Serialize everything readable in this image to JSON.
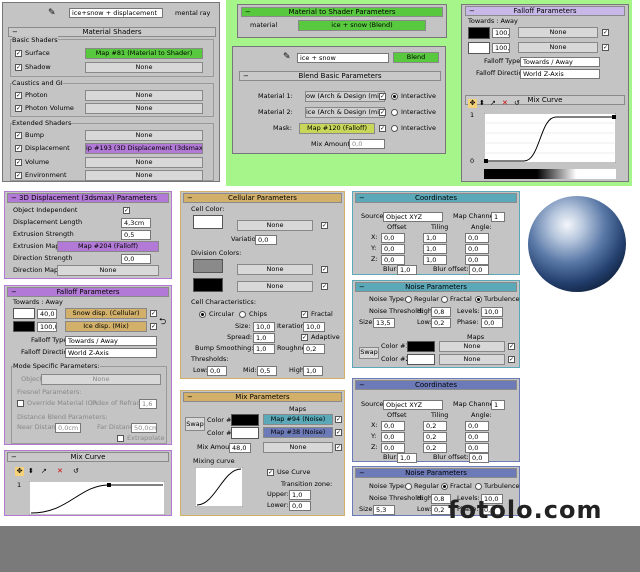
{
  "top_left": {
    "map_dropdown": "ice+snow + displacement",
    "map_type": "mental ray",
    "title": "Material Shaders",
    "basic_header": "Basic Shaders",
    "surface_label": "Surface",
    "surface_map": "Map #81 (Material to Shader)",
    "shadow_label": "Shadow",
    "none": "None",
    "caustics_header": "Caustics and GI",
    "photon_label": "Photon",
    "photon_volume_label": "Photon Volume",
    "extended_header": "Extended Shaders",
    "bump_label": "Bump",
    "displacement_label": "Displacement",
    "displacement_map": "ip #193 (3D Displacement (3dsmax))",
    "volume_label": "Volume",
    "environment_label": "Environment"
  },
  "mat_to_shader": {
    "title": "Material to Shader Parameters",
    "material_label": "material",
    "material_value": "ice + snow (Blend)"
  },
  "blend": {
    "dropdown": "ice + snow",
    "type": "Blend",
    "title": "Blend Basic Parameters",
    "m1_label": "Material 1:",
    "m1_value": "ow (Arch & Design (mi))",
    "m2_label": "Material 2:",
    "m2_value": "ice (Arch & Design (mi))",
    "mask_label": "Mask:",
    "mask_value": "Map #120 (Falloff)",
    "interactive": "Interactive",
    "mix_label": "Mix Amount:",
    "mix_value": "0,0"
  },
  "falloff_top": {
    "title": "Falloff Parameters",
    "towards_label": "Towards : Away",
    "v1": "100,0",
    "v2": "100,0",
    "none": "None",
    "type_label": "Falloff Type:",
    "type_value": "Towards / Away",
    "dir_label": "Falloff Direction:",
    "dir_value": "World Z-Axis",
    "mix_curve": "Mix Curve",
    "y1": "1",
    "y0": "0"
  },
  "disp3d": {
    "title": "3D Displacement (3dsmax) Parameters",
    "obj_ind": "Object Independent",
    "disp_len_label": "Displacement Length",
    "disp_len_value": "4,3cm",
    "ext_str_label": "Extrusion Strength",
    "ext_str_value": "0,5",
    "ext_map_label": "Extrusion Map",
    "ext_map_value": "Map #204 (Falloff)",
    "dir_str_label": "Direction Strength",
    "dir_str_value": "0,0",
    "dir_map_label": "Direction Map",
    "dir_map_value": "None"
  },
  "falloff_bottom": {
    "title": "Falloff Parameters",
    "towards_label": "Towards : Away",
    "v1": "40,0",
    "v2": "100,0",
    "map1": "Snow disp. (Cellular)",
    "map2": "Ice disp. (Mix)",
    "type_label": "Falloff Type:",
    "type_value": "Towards / Away",
    "dir_label": "Falloff Direction:",
    "dir_value": "World Z-Axis",
    "mode_header": "Mode Specific Parameters:",
    "object_label": "Object:",
    "object_value": "None",
    "fresnel_header": "Fresnel Parameters:",
    "override_label": "Override Material IOR",
    "ior_label": "Index of Refraction",
    "ior_value": "1,6",
    "distance_header": "Distance Blend Parameters:",
    "near_label": "Near Distance:",
    "near_value": "0,0cm",
    "far_label": "Far Distance:",
    "far_value": "50,0cm",
    "extrapolate": "Extrapolate",
    "mix_curve": "Mix Curve",
    "y1": "1"
  },
  "cellular": {
    "title": "Cellular Parameters",
    "cell_color": "Cell Color:",
    "none": "None",
    "variation_label": "Variation:",
    "variation_value": "0,0",
    "division_colors": "Division Colors:",
    "characteristics": "Cell Characteristics:",
    "circular": "Circular",
    "chips": "Chips",
    "fractal": "Fractal",
    "size_label": "Size:",
    "size_value": "10,0",
    "iterations_label": "Iterations:",
    "iterations_value": "10,0",
    "spread_label": "Spread:",
    "spread_value": "1,0",
    "adaptive": "Adaptive",
    "bump_label": "Bump Smoothing:",
    "bump_value": "1,0",
    "rough_label": "Roughness:",
    "rough_value": "0,2",
    "thresholds": "Thresholds:",
    "low_label": "Low:",
    "low_value": "0,0",
    "mid_label": "Mid:",
    "mid_value": "0,5",
    "high_label": "High:",
    "high_value": "1,0"
  },
  "mix": {
    "title": "Mix Parameters",
    "maps": "Maps",
    "swap": "Swap",
    "color1": "Color #1",
    "color2": "Color #2",
    "map1": "Map #94 (Noise)",
    "map2": "Map #38 (Noise)",
    "mix_amount_label": "Mix Amount:",
    "mix_amount_value": "48,0",
    "none": "None",
    "mixing_curve": "Mixing curve",
    "use_curve": "Use Curve",
    "transition": "Transition zone:",
    "upper_label": "Upper:",
    "upper_value": "1,0",
    "lower_label": "Lower:",
    "lower_value": "0,0"
  },
  "coords1": {
    "title": "Coordinates",
    "source_label": "Source:",
    "source_value": "Object XYZ",
    "channel_label": "Map Channel:",
    "channel_value": "1",
    "offset": "Offset",
    "tiling": "Tiling",
    "angle": "Angle:",
    "x": "X:",
    "y": "Y:",
    "z": "Z:",
    "ox": "0,0",
    "oy": "0,0",
    "oz": "0,0",
    "tx": "1,0",
    "ty": "1,0",
    "tz": "1,0",
    "ax": "0,0",
    "ay": "0,0",
    "az": "0,0",
    "blur_label": "Blur:",
    "blur_value": "1,0",
    "blur_off_label": "Blur offset:",
    "blur_off_value": "0,0"
  },
  "noise1": {
    "title": "Noise Parameters",
    "type_label": "Noise Type:",
    "regular": "Regular",
    "fractal": "Fractal",
    "turbulence": "Turbulence",
    "thresh_label": "Noise Threshold:",
    "high_label": "High:",
    "high_value": "0,8",
    "levels_label": "Levels:",
    "levels_value": "10,0",
    "size_label": "Size:",
    "size_value": "13,5",
    "low_label": "Low:",
    "low_value": "0,2",
    "phase_label": "Phase:",
    "phase_value": "0,0",
    "maps": "Maps",
    "swap": "Swap",
    "color1": "Color #1",
    "color2": "Color #2",
    "none": "None"
  },
  "coords2": {
    "title": "Coordinates",
    "source_label": "Source:",
    "source_value": "Object XYZ",
    "channel_label": "Map Channel:",
    "channel_value": "1",
    "offset": "Offset",
    "tiling": "Tiling",
    "angle": "Angle:",
    "x": "X:",
    "y": "Y:",
    "z": "Z:",
    "ox": "0,0",
    "oy": "0,0",
    "oz": "0,0",
    "tx": "0,2",
    "ty": "0,2",
    "tz": "0,2",
    "ax": "0,0",
    "ay": "0,0",
    "az": "0,0",
    "blur_label": "Blur:",
    "blur_value": "1,0",
    "blur_off_label": "Blur offset:",
    "blur_off_value": "0,0"
  },
  "noise2": {
    "title": "Noise Parameters",
    "type_label": "Noise Type:",
    "regular": "Regular",
    "fractal": "Fractal",
    "turbulence": "Turbulence",
    "thresh_label": "Noise Threshold:",
    "high_label": "High:",
    "high_value": "0,8",
    "levels_label": "Levels:",
    "levels_value": "10,0",
    "size_label": "Size:",
    "size_value": "5,3",
    "low_label": "Low:",
    "low_value": "0,2",
    "phase_label": "Phase:",
    "phase_value": "0,0"
  },
  "watermark": "fotolo.com"
}
